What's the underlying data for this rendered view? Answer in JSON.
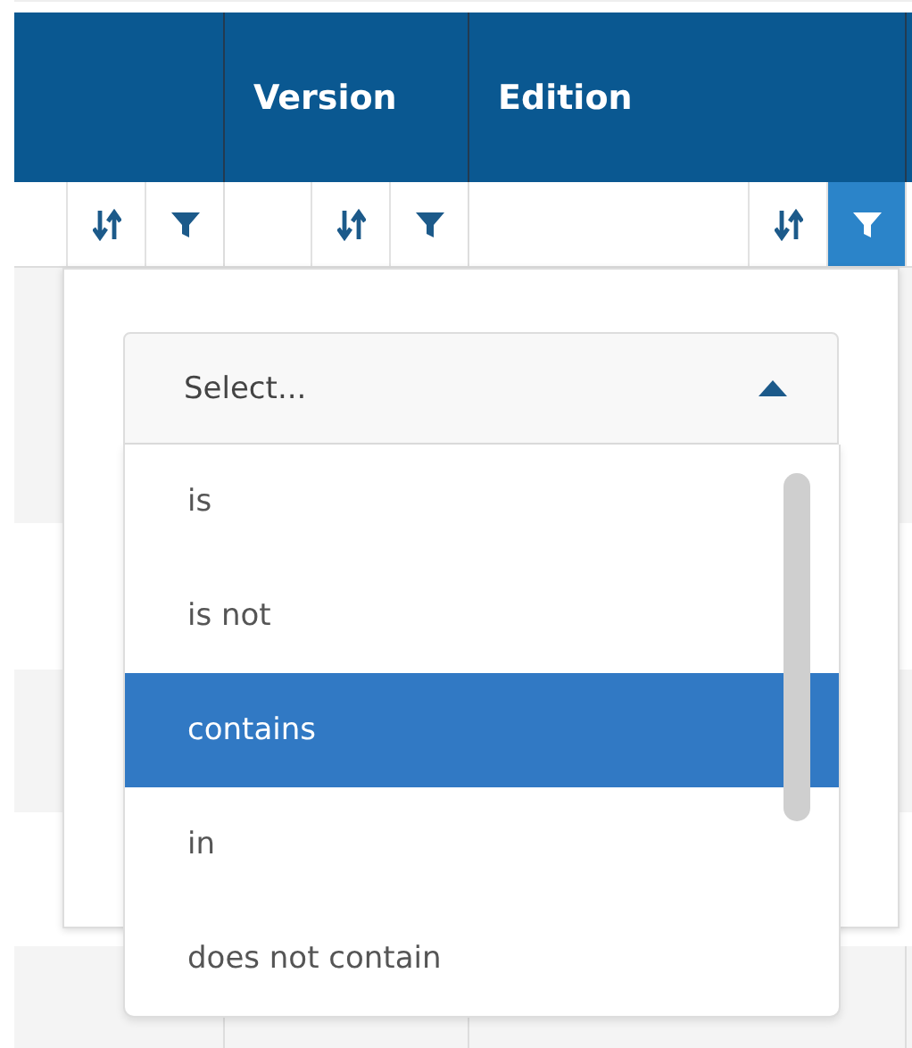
{
  "table": {
    "columns": [
      {
        "filter_active": false
      },
      {
        "label": "Version",
        "filter_active": false
      },
      {
        "label": "Edition",
        "filter_active": true
      }
    ]
  },
  "filter_popup": {
    "select": {
      "placeholder": "Select...",
      "expanded": true
    },
    "options": [
      {
        "label": "is",
        "selected": false
      },
      {
        "label": "is not",
        "selected": false
      },
      {
        "label": "contains",
        "selected": true
      },
      {
        "label": "in",
        "selected": false
      },
      {
        "label": "does not contain",
        "selected": false
      }
    ]
  }
}
